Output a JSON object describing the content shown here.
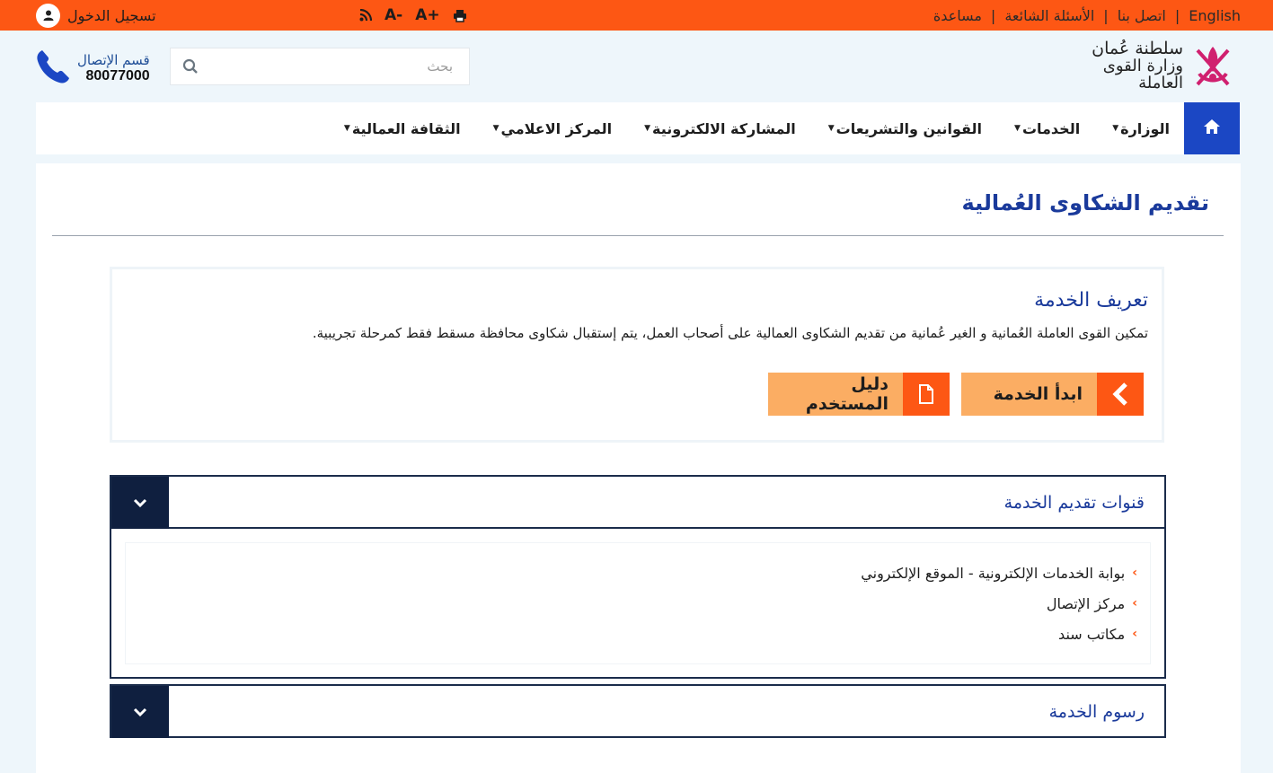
{
  "topbar": {
    "links": [
      "مساعدة",
      "الأسئلة الشائعة",
      "اتصل بنا",
      "English"
    ],
    "separator": "|",
    "font_decrease": "A-",
    "font_increase": "A+",
    "login": "تسجيل الدخول",
    "color": "#fd5714"
  },
  "header": {
    "logo_line1": "سلطنة عُمان",
    "logo_line2": "وزارة القوى العاملة",
    "search": {
      "placeholder": "بحث"
    },
    "call": {
      "label": "قسم الإتصال",
      "number": "80077000"
    }
  },
  "nav": {
    "items": [
      {
        "label": "الوزارة"
      },
      {
        "label": "الخدمات"
      },
      {
        "label": "القوانين والتشريعات"
      },
      {
        "label": "المشاركة الالكترونية"
      },
      {
        "label": "المركز الاعلامي"
      },
      {
        "label": "الثقافة العمالية"
      }
    ],
    "home_color": "#1b47c4"
  },
  "page": {
    "title": "تقديم الشكاوى العُمالية",
    "service": {
      "heading": "تعريف الخدمة",
      "description": "تمكين القوى العاملة العُمانية و الغير عُمانية من تقديم الشكاوى العمالية على أصحاب العمل، يتم إستقبال شكاوى محافظة مسقط فقط كمرحلة تجريبية.",
      "start_button": "ابدأ الخدمة",
      "guide_button": "دليل المستخدم"
    },
    "channels": {
      "title": "قنوات تقديم الخدمة",
      "items": [
        "بوابة الخدمات الإلكترونية - الموقع الإلكتروني",
        "مركز الإتصال",
        "مكاتب سند"
      ]
    },
    "fees": {
      "title": "رسوم الخدمة"
    }
  }
}
